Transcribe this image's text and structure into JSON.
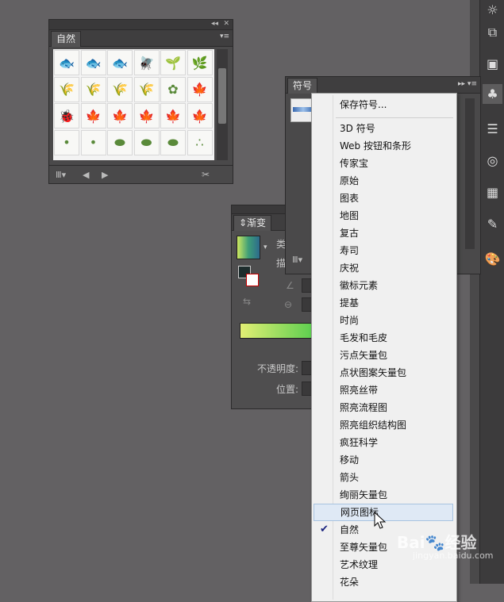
{
  "nature_panel": {
    "tab_label": "自然",
    "menu_glyph": "▾≡",
    "collapse_glyph": "◂◂",
    "close_glyph": "✕",
    "grid_icons": [
      "fish-icon",
      "fish-icon",
      "fish-icon",
      "fly-icon",
      "sprout-icon",
      "plant-icon",
      "grass-icon",
      "grass-icon",
      "grass-icon",
      "grass-icon",
      "flower-icon",
      "leaf-icon",
      "ladybug-icon",
      "leaf-icon",
      "leaf-icon",
      "leaf-icon",
      "leaf-icon",
      "leaf-icon",
      "seed-icon",
      "seed-icon",
      "rock-icon",
      "rock-icon",
      "rock-icon",
      "sand-icon"
    ],
    "bottom_icons": [
      "library-icon",
      "prev-icon",
      "next-icon",
      "break-link-icon"
    ]
  },
  "symbols_panel": {
    "tab_label": "符号",
    "menu_glyph": "▸▸ ▾≡"
  },
  "gradient_panel": {
    "tab_label": "⇕渐变",
    "type_label": "类",
    "stroke_label": "描",
    "opacity_label": "不透明度:",
    "position_label": "位置:"
  },
  "symbols_menu": {
    "save_item": "保存符号...",
    "items": [
      "3D 符号",
      "Web 按钮和条形",
      "传家宝",
      "原始",
      "图表",
      "地图",
      "复古",
      "寿司",
      "庆祝",
      "徽标元素",
      "提基",
      "时尚",
      "毛发和毛皮",
      "污点矢量包",
      "点状图案矢量包",
      "照亮丝带",
      "照亮流程图",
      "照亮组织结构图",
      "疯狂科学",
      "移动",
      "箭头",
      "绚丽矢量包",
      "网页图标",
      "自然",
      "至尊矢量包",
      "艺术纹理",
      "花朵"
    ],
    "hovered": "网页图标",
    "checked": "自然"
  },
  "watermark": {
    "text": "Bai🐾经验",
    "sub": "jingyan.baidu.com"
  }
}
